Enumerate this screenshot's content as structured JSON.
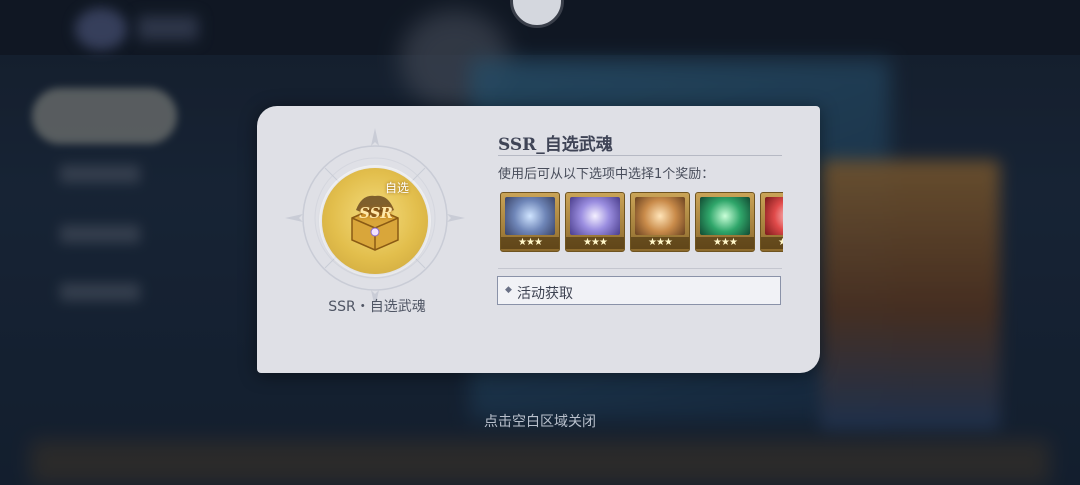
{
  "dialog": {
    "title": "SSR_自选武魂",
    "description": "使用后可从以下选项中选择1个奖励：",
    "item": {
      "name": "SSR・自选武魂",
      "badge": "自选",
      "rarity": "SSR",
      "icon": "gold-chest-icon"
    },
    "rewards": [
      {
        "icon": "spear-weapon-icon",
        "stars": "★★★",
        "color": "#6f86b8"
      },
      {
        "icon": "moon-wing-icon",
        "stars": "★★★",
        "color": "#9b8ee0"
      },
      {
        "icon": "gold-orb-icon",
        "stars": "★★★",
        "color": "#c98b4a"
      },
      {
        "icon": "green-crystal-icon",
        "stars": "★★★",
        "color": "#2fa66a"
      },
      {
        "icon": "red-gem-icon",
        "stars": "★★★",
        "color": "#e04a4a"
      }
    ],
    "source": {
      "label": "活动获取"
    }
  },
  "hint": "点击空白区域关闭"
}
